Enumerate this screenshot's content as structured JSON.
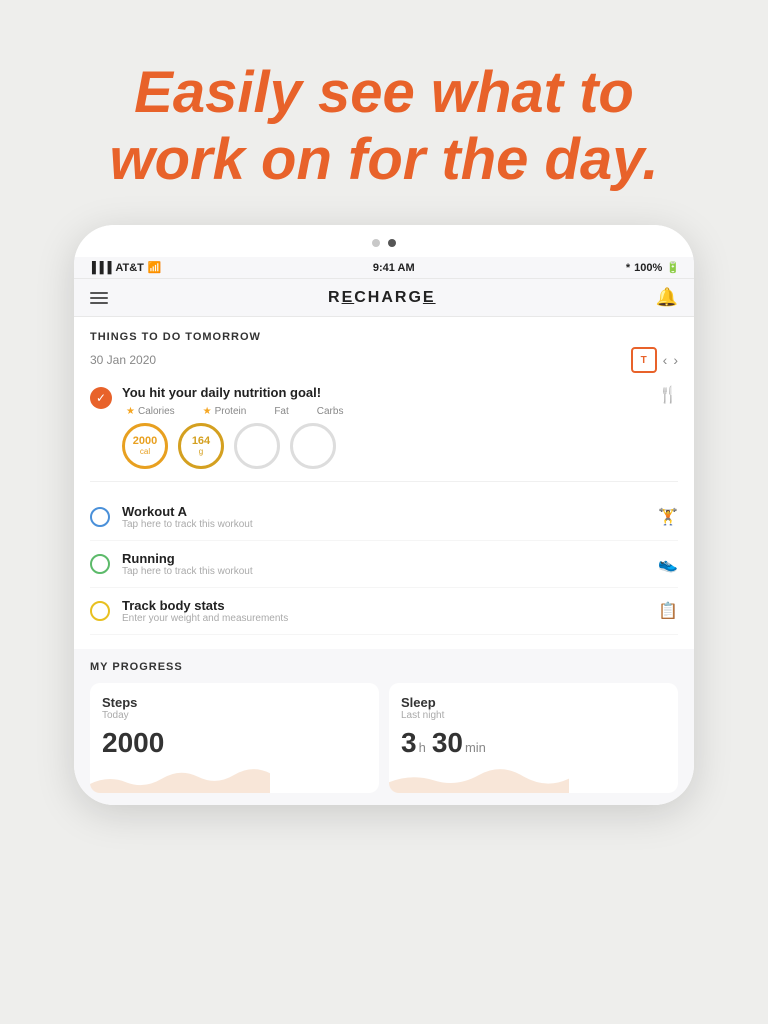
{
  "hero": {
    "line1": "Easily see what to",
    "line2": "work on for the day."
  },
  "status_bar": {
    "carrier": "AT&T",
    "wifi": true,
    "time": "9:41 AM",
    "bluetooth": "100%"
  },
  "app": {
    "title": "RECHARGE",
    "section": "THINGS TO DO TOMORROW",
    "date": "30 Jan 2020"
  },
  "dots": {
    "inactive": "●",
    "active": "●"
  },
  "nutrition": {
    "title": "You hit your daily nutrition goal!",
    "macros": [
      {
        "label": "Calories",
        "starred": true,
        "value": "2000",
        "unit": "cal",
        "filled": true,
        "color": "orange"
      },
      {
        "label": "Protein",
        "starred": true,
        "value": "164",
        "unit": "g",
        "filled": true,
        "color": "gold"
      },
      {
        "label": "Fat",
        "starred": false,
        "value": "",
        "unit": "",
        "filled": false,
        "color": "empty"
      },
      {
        "label": "Carbs",
        "starred": false,
        "value": "",
        "unit": "",
        "filled": false,
        "color": "empty"
      }
    ]
  },
  "tasks": [
    {
      "name": "Workout A",
      "sub": "Tap here to track this workout",
      "circle": "blue",
      "icon": "🏋"
    },
    {
      "name": "Running",
      "sub": "Tap here to track this workout",
      "circle": "green",
      "icon": "👟"
    },
    {
      "name": "Track body stats",
      "sub": "Enter your weight and measurements",
      "circle": "yellow",
      "icon": "📋"
    }
  ],
  "progress": {
    "title": "MY PROGRESS",
    "cards": [
      {
        "label": "Steps",
        "sub": "Today",
        "value": "2000",
        "unit": ""
      },
      {
        "label": "Sleep",
        "sub": "Last night",
        "value_h": "3",
        "value_m": "30",
        "unit_h": "h",
        "unit_m": "min"
      }
    ]
  }
}
